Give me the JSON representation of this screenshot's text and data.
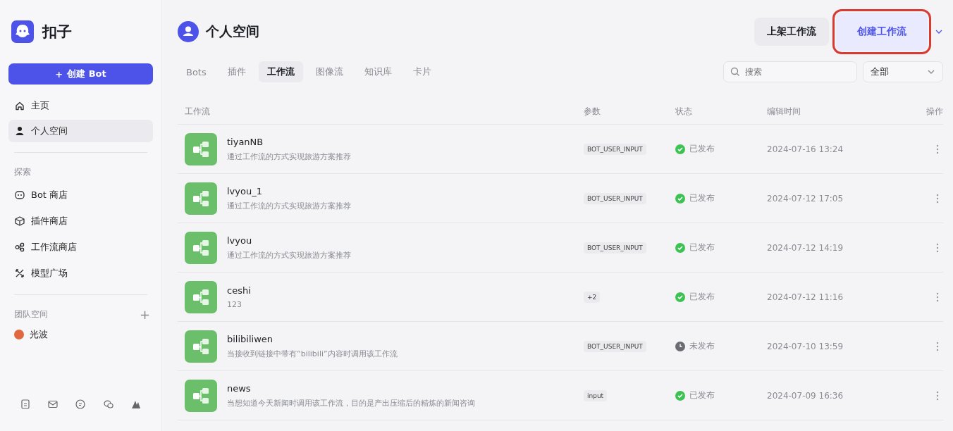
{
  "sidebar": {
    "brand": "扣子",
    "create_button": {
      "icon": "+",
      "label": "创建 Bot"
    },
    "nav": [
      {
        "label": "主页",
        "kind": "home",
        "selected": false
      },
      {
        "label": "个人空间",
        "kind": "person",
        "selected": true
      }
    ],
    "explore_title": "探索",
    "explore": [
      {
        "label": "Bot 商店",
        "kind": "bot",
        "selected": false
      },
      {
        "label": "插件商店",
        "kind": "cube",
        "selected": false
      },
      {
        "label": "工作流商店",
        "kind": "flow",
        "selected": false
      },
      {
        "label": "模型广场",
        "kind": "model",
        "selected": false
      }
    ],
    "team_title": "团队空间",
    "team_add": "+",
    "teams": [
      {
        "label": "光波",
        "color": "#e0673f"
      }
    ]
  },
  "header": {
    "title": "个人空间",
    "buttons": [
      {
        "label": "上架工作流",
        "kind": "secondary",
        "highlighted": false
      },
      {
        "label": "创建工作流",
        "kind": "primary",
        "highlighted": true
      }
    ]
  },
  "tabs": [
    {
      "label": "Bots",
      "selected": false
    },
    {
      "label": "插件",
      "selected": false
    },
    {
      "label": "工作流",
      "selected": true
    },
    {
      "label": "图像流",
      "selected": false
    },
    {
      "label": "知识库",
      "selected": false
    },
    {
      "label": "卡片",
      "selected": false
    }
  ],
  "search": {
    "placeholder": "搜索"
  },
  "filter": {
    "value": "全部"
  },
  "table": {
    "columns": [
      "工作流",
      "参数",
      "状态",
      "编辑时间",
      "操作"
    ],
    "rows": [
      {
        "name": "tiyanNB",
        "description": "通过工作流的方式实现旅游方案推荐",
        "param": "BOT_USER_INPUT",
        "published": true,
        "status": "已发布",
        "edited": "2024-07-16 13:24"
      },
      {
        "name": "lvyou_1",
        "description": "通过工作流的方式实现旅游方案推荐",
        "param": "BOT_USER_INPUT",
        "published": true,
        "status": "已发布",
        "edited": "2024-07-12 17:05"
      },
      {
        "name": "lvyou",
        "description": "通过工作流的方式实现旅游方案推荐",
        "param": "BOT_USER_INPUT",
        "published": true,
        "status": "已发布",
        "edited": "2024-07-12 14:19"
      },
      {
        "name": "ceshi",
        "description": "123",
        "param": "+2",
        "published": true,
        "status": "已发布",
        "edited": "2024-07-12 11:16"
      },
      {
        "name": "bilibiliwen",
        "description": "当接收到链接中带有“bilibili”内容时调用该工作流",
        "param": "BOT_USER_INPUT",
        "published": false,
        "status": "未发布",
        "edited": "2024-07-10 13:59"
      },
      {
        "name": "news",
        "description": "当想知道今天新闻时调用该工作流，目的是产出压缩后的精炼的新闻咨询",
        "param": "input",
        "published": true,
        "status": "已发布",
        "edited": "2024-07-09 16:36"
      }
    ]
  }
}
